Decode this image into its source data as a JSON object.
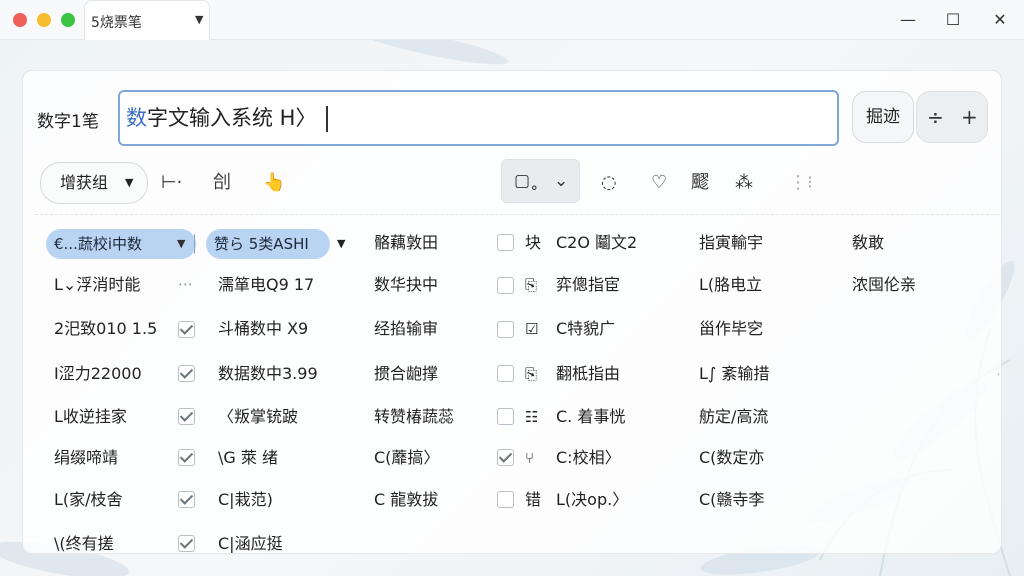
{
  "window": {
    "tab_title": "5烧票笔",
    "controls": {
      "minimize": "—",
      "maximize": "☐",
      "close": "✕"
    }
  },
  "input_bar": {
    "label": "数字1笔",
    "value_highlight": "数",
    "value_rest": "字文输入系统 H〉",
    "confirm_label": "掘迹",
    "minus_label": "÷",
    "plus_label": "+"
  },
  "toolbar": {
    "group_dropdown": "增获组",
    "items": [
      "⊢·",
      "㓣",
      "👆",
      "▢˳",
      "⌄",
      "◌",
      "♡",
      "飂",
      "⁂",
      "⋮⁝"
    ]
  },
  "table": {
    "header_pills": [
      "€...蔬校i中数",
      "赞ら 5类ASHI"
    ],
    "columns": [
      {
        "cells": [
          "L⌄浮消时能",
          "2汜致010 1.5",
          "I涩力22000",
          "L收逆挂家",
          "绢缀啼靖",
          "L(家/枝舍",
          "\\(终有搓"
        ]
      },
      {
        "checks": [
          "dash",
          "checked",
          "checked",
          "checked",
          "checked",
          "checked",
          "checked"
        ]
      },
      {
        "cells": [
          "濡箪电Q9 17",
          "斗桶数中 X9",
          "数据数中3.99",
          "〈叛掌铳跛",
          "\\G 萊 绪",
          "C|栽范)",
          "C|涵应挺"
        ]
      },
      {
        "cells": [
          "骼藕敦田",
          "数华抉中",
          "经掐输审",
          "掼合龅撑",
          "转赞椿蔬蕊",
          "C(蘼搞〉",
          "C 龍敦拔"
        ]
      },
      {
        "checks": [
          "unchecked",
          "unchecked",
          "unchecked",
          "unchecked",
          "unchecked",
          "unchecked",
          "checked",
          "unchecked"
        ],
        "labels": [
          "块",
          "",
          "",
          "",
          "",
          "",
          "",
          "错"
        ]
      },
      {
        "cells": [
          "C2O 鬮文2",
          "弈傯指宦",
          "C特貌广",
          "翻柢指由",
          "C. 着事恍",
          "C:校相〉",
          "L(决op.〉"
        ],
        "icons": [
          "",
          "doc-icon",
          "check-doc-icon",
          "doc-icon",
          "list-icon",
          "branch-icon",
          ""
        ]
      },
      {
        "cells": [
          "指寅輸宇",
          "L(胳电立",
          "甾作毕穵",
          "L∫ 紊输措",
          "舫定/高流",
          "C(数定亦",
          "C(赣寺李"
        ]
      },
      {
        "cells": [
          "敎敢",
          "浓囤伦亲"
        ]
      }
    ]
  }
}
